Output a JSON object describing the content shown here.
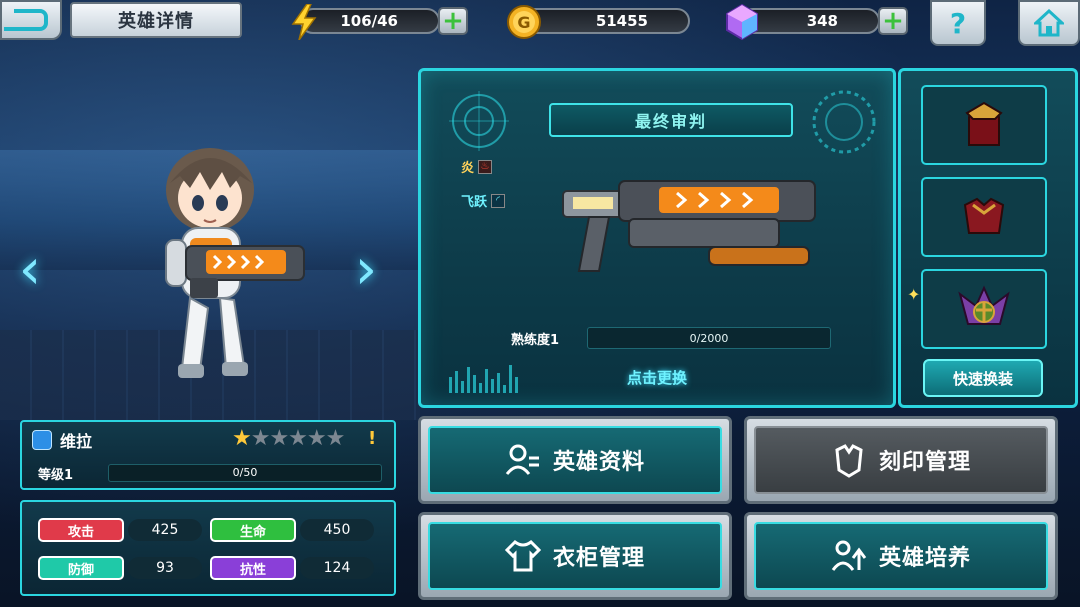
{
  "header": {
    "title": "英雄详情",
    "energy": "106/46",
    "gold": "51455",
    "gems": "348",
    "help": "?"
  },
  "weapon": {
    "name": "最终审判",
    "element_tag": "炎",
    "skill_tag": "飞跃",
    "proficiency_label": "熟练度1",
    "proficiency_value": "0/2000",
    "proficiency_fraction": 0,
    "tap_to_change": "点击更换"
  },
  "equipment": {
    "quick_equip": "快速换装"
  },
  "hero": {
    "name": "维拉",
    "stars_filled": 1,
    "stars_total": 6,
    "alert": "!",
    "level_label": "等级1",
    "exp_value": "0/50",
    "exp_fraction": 0
  },
  "stats": [
    {
      "label": "攻击",
      "value": "425",
      "color": "#e03a4a"
    },
    {
      "label": "生命",
      "value": "450",
      "color": "#2fbf3f"
    },
    {
      "label": "防御",
      "value": "93",
      "color": "#1fc9a8"
    },
    {
      "label": "抗性",
      "value": "124",
      "color": "#8a3fd8"
    }
  ],
  "menu": {
    "hero_info": "英雄资料",
    "imprint": "刻印管理",
    "wardrobe": "衣柜管理",
    "training": "英雄培养"
  },
  "colors": {
    "accent": "#2bd6e0",
    "gold": "#ffc93a"
  }
}
